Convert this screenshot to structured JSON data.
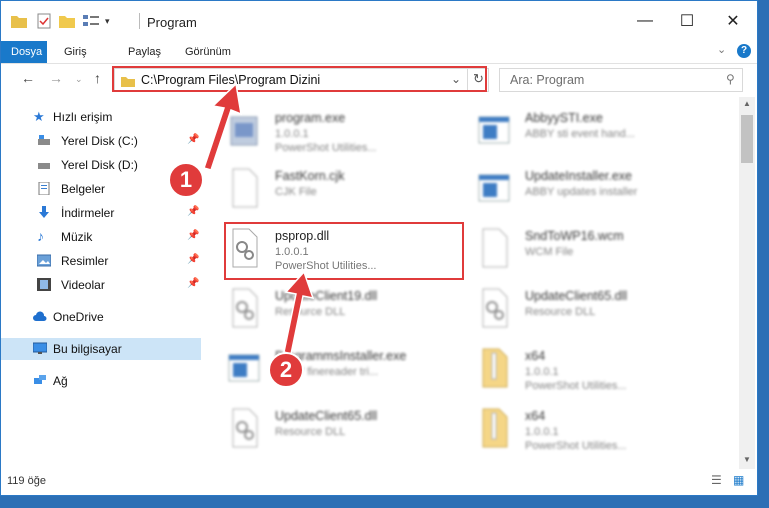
{
  "titlebar": {
    "title": "Program"
  },
  "window_controls": {
    "minimize": "—",
    "maximize": "☐",
    "close": "✕"
  },
  "ribbon": {
    "tabs": [
      "Dosya",
      "Giriş",
      "Paylaş",
      "Görünüm"
    ],
    "help": "?"
  },
  "address": {
    "path": "C:\\Program Files\\Program Dizini"
  },
  "search": {
    "placeholder": "Ara: Program"
  },
  "sidebar": {
    "items": [
      {
        "label": "Hızlı erişim"
      },
      {
        "label": "Yerel Disk (C:)"
      },
      {
        "label": "Yerel Disk (D:)"
      },
      {
        "label": "Belgeler"
      },
      {
        "label": "İndirmeler"
      },
      {
        "label": "Müzik"
      },
      {
        "label": "Resimler"
      },
      {
        "label": "Videolar"
      },
      {
        "label": "OneDrive"
      },
      {
        "label": "Bu bilgisayar"
      },
      {
        "label": "Ağ"
      }
    ]
  },
  "files": [
    {
      "name": "program.exe",
      "line1": "1.0.0.1",
      "line2": "PowerShot Utilities..."
    },
    {
      "name": "AbbyySTI.exe",
      "line1": "ABBY sti event hand...",
      "line2": ""
    },
    {
      "name": "FastKorn.cjk",
      "line1": "CJK File",
      "line2": ""
    },
    {
      "name": "UpdateInstaller.exe",
      "line1": "ABBY updates installer",
      "line2": ""
    },
    {
      "name": "psprop.dll",
      "line1": "1.0.0.1",
      "line2": "PowerShot Utilities..."
    },
    {
      "name": "SndToWP16.wcm",
      "line1": "WCM File",
      "line2": ""
    },
    {
      "name": "UpdateClient19.dll",
      "line1": "Resource DLL",
      "line2": ""
    },
    {
      "name": "UpdateClient65.dll",
      "line1": "Resource DLL",
      "line2": ""
    },
    {
      "name": "ProgrammsInstaller.exe",
      "line1": "ABBY finereader tri...",
      "line2": ""
    },
    {
      "name": "x64",
      "line1": "1.0.0.1",
      "line2": "PowerShot Utilities..."
    },
    {
      "name": "UpdateClient65.dll",
      "line1": "Resource DLL",
      "line2": ""
    },
    {
      "name": "x64",
      "line1": "1.0.0.1",
      "line2": "PowerShot Utilities..."
    }
  ],
  "status": {
    "count": "119 öğe"
  },
  "callouts": {
    "one": "1",
    "two": "2"
  },
  "colors": {
    "accent": "#1979ca",
    "highlight": "#e03b3b"
  }
}
